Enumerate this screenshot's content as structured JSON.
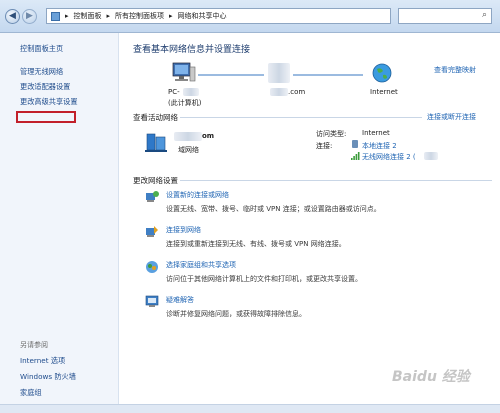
{
  "address": {
    "segments": [
      "控制面板",
      "所有控制面板项",
      "网络和共享中心"
    ]
  },
  "sidebar": {
    "home": "控制面板主页",
    "items": [
      "管理无线网络",
      "更改适配器设置",
      "更改高级共享设置"
    ],
    "see_also_title": "另请参阅",
    "see_also": [
      "Internet 选项",
      "Windows 防火墙",
      "家庭组"
    ]
  },
  "main": {
    "title": "查看基本网络信息并设置连接",
    "full_map": "查看完整映射",
    "nodes": {
      "pc_name": "PC-",
      "pc_sub": "(此计算机)",
      "mid": ".com",
      "internet": "Internet"
    },
    "active_title": "查看活动网络",
    "connect_link": "连接或断开连接",
    "active": {
      "name": "om",
      "type": "域网络",
      "access_label": "访问类型:",
      "access_value": "Internet",
      "conn_label": "连接:",
      "conn_items": [
        "本地连接 2",
        "无线网络连接 2 ("
      ]
    },
    "change_title": "更改网络设置",
    "tasks": [
      {
        "title": "设置新的连接或网络",
        "desc": "设置无线、宽带、拨号、临时或 VPN 连接；或设置路由器或访问点。"
      },
      {
        "title": "连接到网络",
        "desc": "连接到或重新连接到无线、有线、拨号或 VPN 网络连接。"
      },
      {
        "title": "选择家庭组和共享选项",
        "desc": "访问位于其他网络计算机上的文件和打印机，或更改共享设置。"
      },
      {
        "title": "疑难解答",
        "desc": "诊断并修复网络问题，或获得故障排除信息。"
      }
    ]
  },
  "watermark": "Baidu 经验"
}
